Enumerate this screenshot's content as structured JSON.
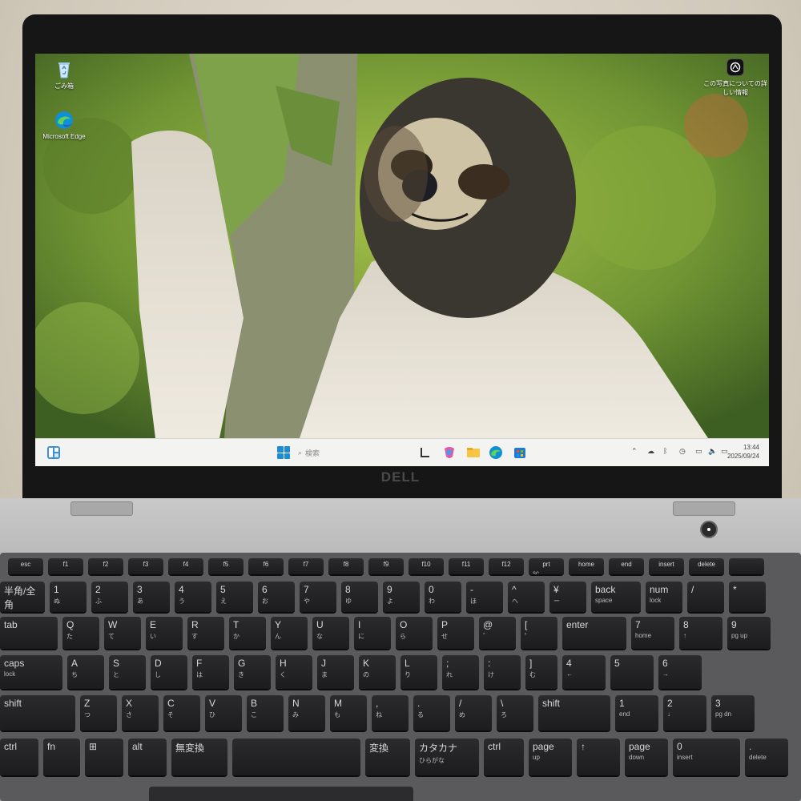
{
  "device": {
    "brand_logo": "DELL"
  },
  "desktop": {
    "icons": [
      {
        "label": "ごみ箱",
        "icon": "recycle-bin-icon"
      },
      {
        "label": "Microsoft Edge",
        "icon": "edge-icon"
      }
    ],
    "about_photo_label": "この写真についての詳しい情報"
  },
  "taskbar": {
    "search_placeholder": "検索",
    "time": "13:44",
    "date": "2025/09/24",
    "apps": [
      "widgets-icon",
      "start-icon",
      "search-icon",
      "task-view-icon",
      "copilot-icon",
      "file-explorer-icon",
      "edge-icon",
      "store-icon"
    ]
  },
  "keyboard": {
    "rows": [
      [
        "esc",
        "f1",
        "f2",
        "f3",
        "f4",
        "f5",
        "f6",
        "f7",
        "f8",
        "f9",
        "f10",
        "f11",
        "f12",
        "prt sc",
        "home",
        "end",
        "insert",
        "delete",
        "",
        "",
        "",
        "←"
      ],
      [
        "半角/全角",
        "1 ぬ",
        "2 ふ",
        "3 あ",
        "4 う",
        "5 え",
        "6 お",
        "7 や",
        "8 ゆ",
        "9 よ",
        "0 わ",
        "- ほ",
        "^ へ",
        "¥ ー",
        "back space",
        "num lock",
        "/",
        "*"
      ],
      [
        "tab",
        "Q た",
        "W て",
        "E い",
        "R す",
        "T か",
        "Y ん",
        "U な",
        "I に",
        "O ら",
        "P せ",
        "@ ゛",
        "[ ゜",
        "enter",
        "7 home",
        "8 ↑",
        "9 pg up"
      ],
      [
        "caps lock",
        "A ち",
        "S と",
        "D し",
        "F は",
        "G き",
        "H く",
        "J ま",
        "K の",
        "L り",
        "; れ",
        ": け",
        "] む",
        "4 ←",
        "5",
        "6 →"
      ],
      [
        "shift",
        "Z つ",
        "X さ",
        "C そ",
        "V ひ",
        "B こ",
        "N み",
        "M も",
        ", ね",
        ". る",
        "/ め",
        "\\ ろ",
        "shift",
        "1 end",
        "2 ↓",
        "3 pg dn"
      ],
      [
        "ctrl",
        "fn",
        "⊞",
        "alt",
        "無変換",
        "",
        "変換",
        "カタカナ ひらがな",
        "ctrl",
        "page up",
        "↑",
        "page down",
        "0 insert",
        ". delete"
      ]
    ]
  }
}
